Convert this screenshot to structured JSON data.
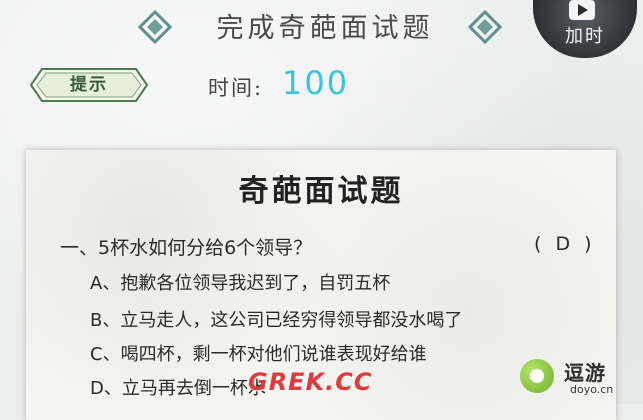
{
  "header": {
    "title": "完成奇葩面试题",
    "add_time_label": "加时"
  },
  "toolbar": {
    "hint_label": "提示",
    "time_label": "时间:",
    "time_value": "100"
  },
  "paper": {
    "title": "奇葩面试题",
    "question": "一、5杯水如何分给6个领导？",
    "answer": "( D )",
    "options": [
      "A、抱歉各位领导我迟到了，自罚五杯",
      "B、立马走人，这公司已经穷得领导都没水喝了",
      "C、喝四杯，剩一杯对他们说谁表现好给谁",
      "D、立马再去倒一杯水"
    ]
  },
  "watermarks": {
    "grek": "GREK.CC",
    "doyo_cn": "逗游",
    "doyo_en": "doyo.cn"
  },
  "colors": {
    "accent_time": "#37c5e0",
    "deco_teal": "#5e8f8f",
    "hint_green": "#3b5a3c"
  }
}
